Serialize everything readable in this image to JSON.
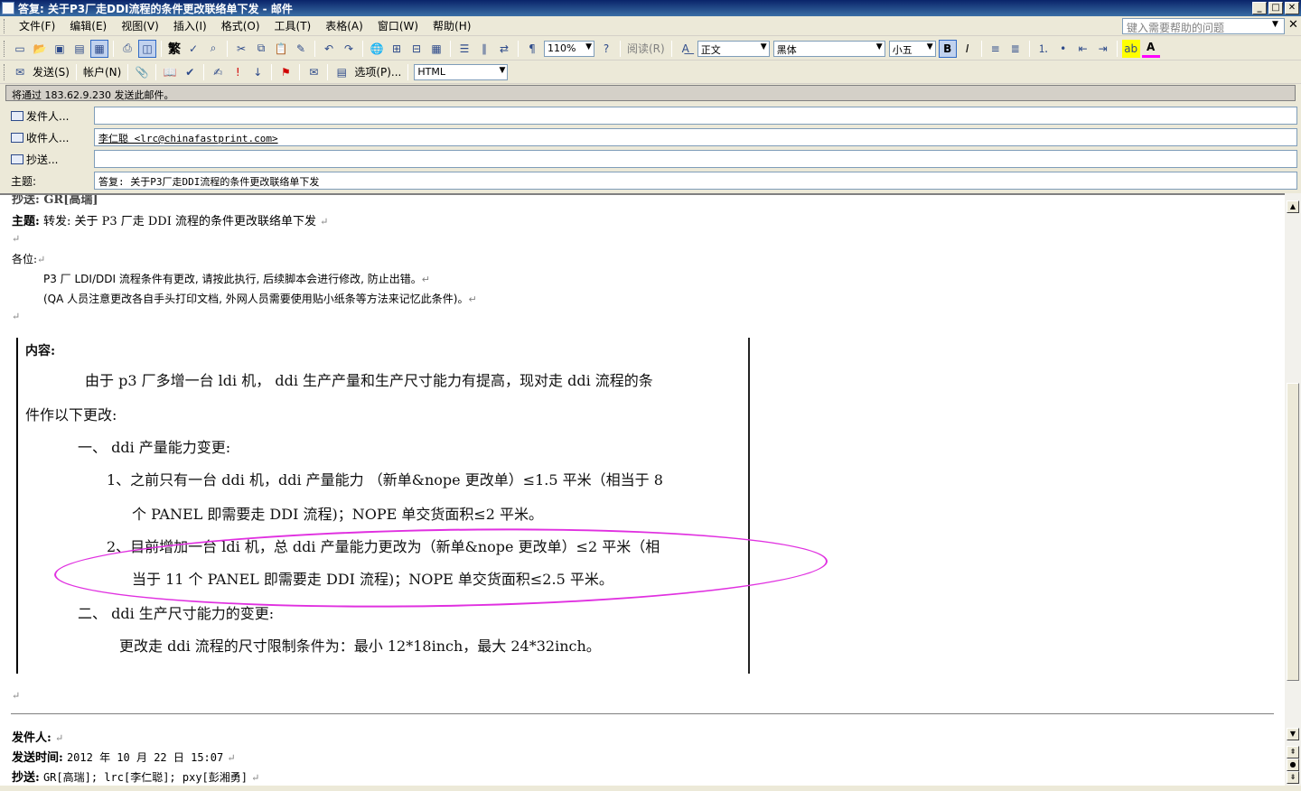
{
  "window": {
    "title": "答复: 关于P3厂走DDI流程的条件更改联络单下发 - 邮件",
    "buttons": [
      "_",
      "□",
      "✕"
    ]
  },
  "menu": {
    "items": [
      "文件(F)",
      "编辑(E)",
      "视图(V)",
      "插入(I)",
      "格式(O)",
      "工具(T)",
      "表格(A)",
      "窗口(W)",
      "帮助(H)"
    ],
    "help_placeholder": "键入需要帮助的问题"
  },
  "toolbar1": {
    "traditional": "繁",
    "zoom": "110%",
    "read": "阅读(R)",
    "style": "正文",
    "font": "黑体",
    "size": "小五",
    "bold": "B",
    "italic": "I",
    "font_color_letter": "A"
  },
  "toolbar2": {
    "send": "发送(S)",
    "account": "帐户(N)",
    "options": "选项(P)...",
    "format": "HTML"
  },
  "infobar": "将通过 183.62.9.230 发送此邮件。",
  "fields": {
    "from_label": "发件人...",
    "from_value": "",
    "to_label": "收件人...",
    "to_value": "李仁聪 <lrc@chinafastprint.com>",
    "cc_label": "抄送...",
    "cc_value": "",
    "subject_label": "主题:",
    "subject_value": "答复: 关于P3厂走DDI流程的条件更改联络单下发"
  },
  "body": {
    "cut_line": "抄送: GR[高瑞]",
    "subject_label": "主题:",
    "subject_text": "转发: 关于 P3 厂走 DDI 流程的条件更改联络单下发",
    "greeting": "各位:",
    "para1": "P3 厂 LDI/DDI 流程条件有更改, 请按此执行, 后续脚本会进行修改, 防止出错。",
    "para2": "(QA 人员注意更改各自手头打印文档, 外网人员需要使用贴小纸条等方法来记忆此条件)。",
    "return_mark": "↵",
    "from_label": "发件人:",
    "from_value": "",
    "sent_label": "发送时间:",
    "sent_value": "2012 年 10 月 22 日 15:07",
    "cc_label": "抄送:",
    "cc_value": "GR[高瑞]; lrc[李仁聪]; pxy[彭湘勇]"
  },
  "scan": {
    "heading": "内容:",
    "l1": "由于 p3 厂多增一台 ldi 机， ddi 生产产量和生产尺寸能力有提高，现对走 ddi 流程的条",
    "l2": "件作以下更改:",
    "l3": "一、 ddi 产量能力变更:",
    "l4": "1、之前只有一台 ddi 机，ddi 产量能力 （新单&nope 更改单）≤1.5 平米（相当于 8",
    "l5": "个 PANEL 即需要走 DDI 流程)；NOPE 单交货面积≤2 平米。",
    "l6": "2、目前增加一台 ldi 机，总 ddi 产量能力更改为（新单&nope 更改单）≤2 平米（相",
    "l7": "当于 11 个 PANEL 即需要走 DDI 流程)；NOPE 单交货面积≤2.5 平米。",
    "l8": "二、 ddi 生产尺寸能力的变更:",
    "l9": "更改走 ddi 流程的尺寸限制条件为：最小 12*18inch，最大 24*32inch。"
  }
}
